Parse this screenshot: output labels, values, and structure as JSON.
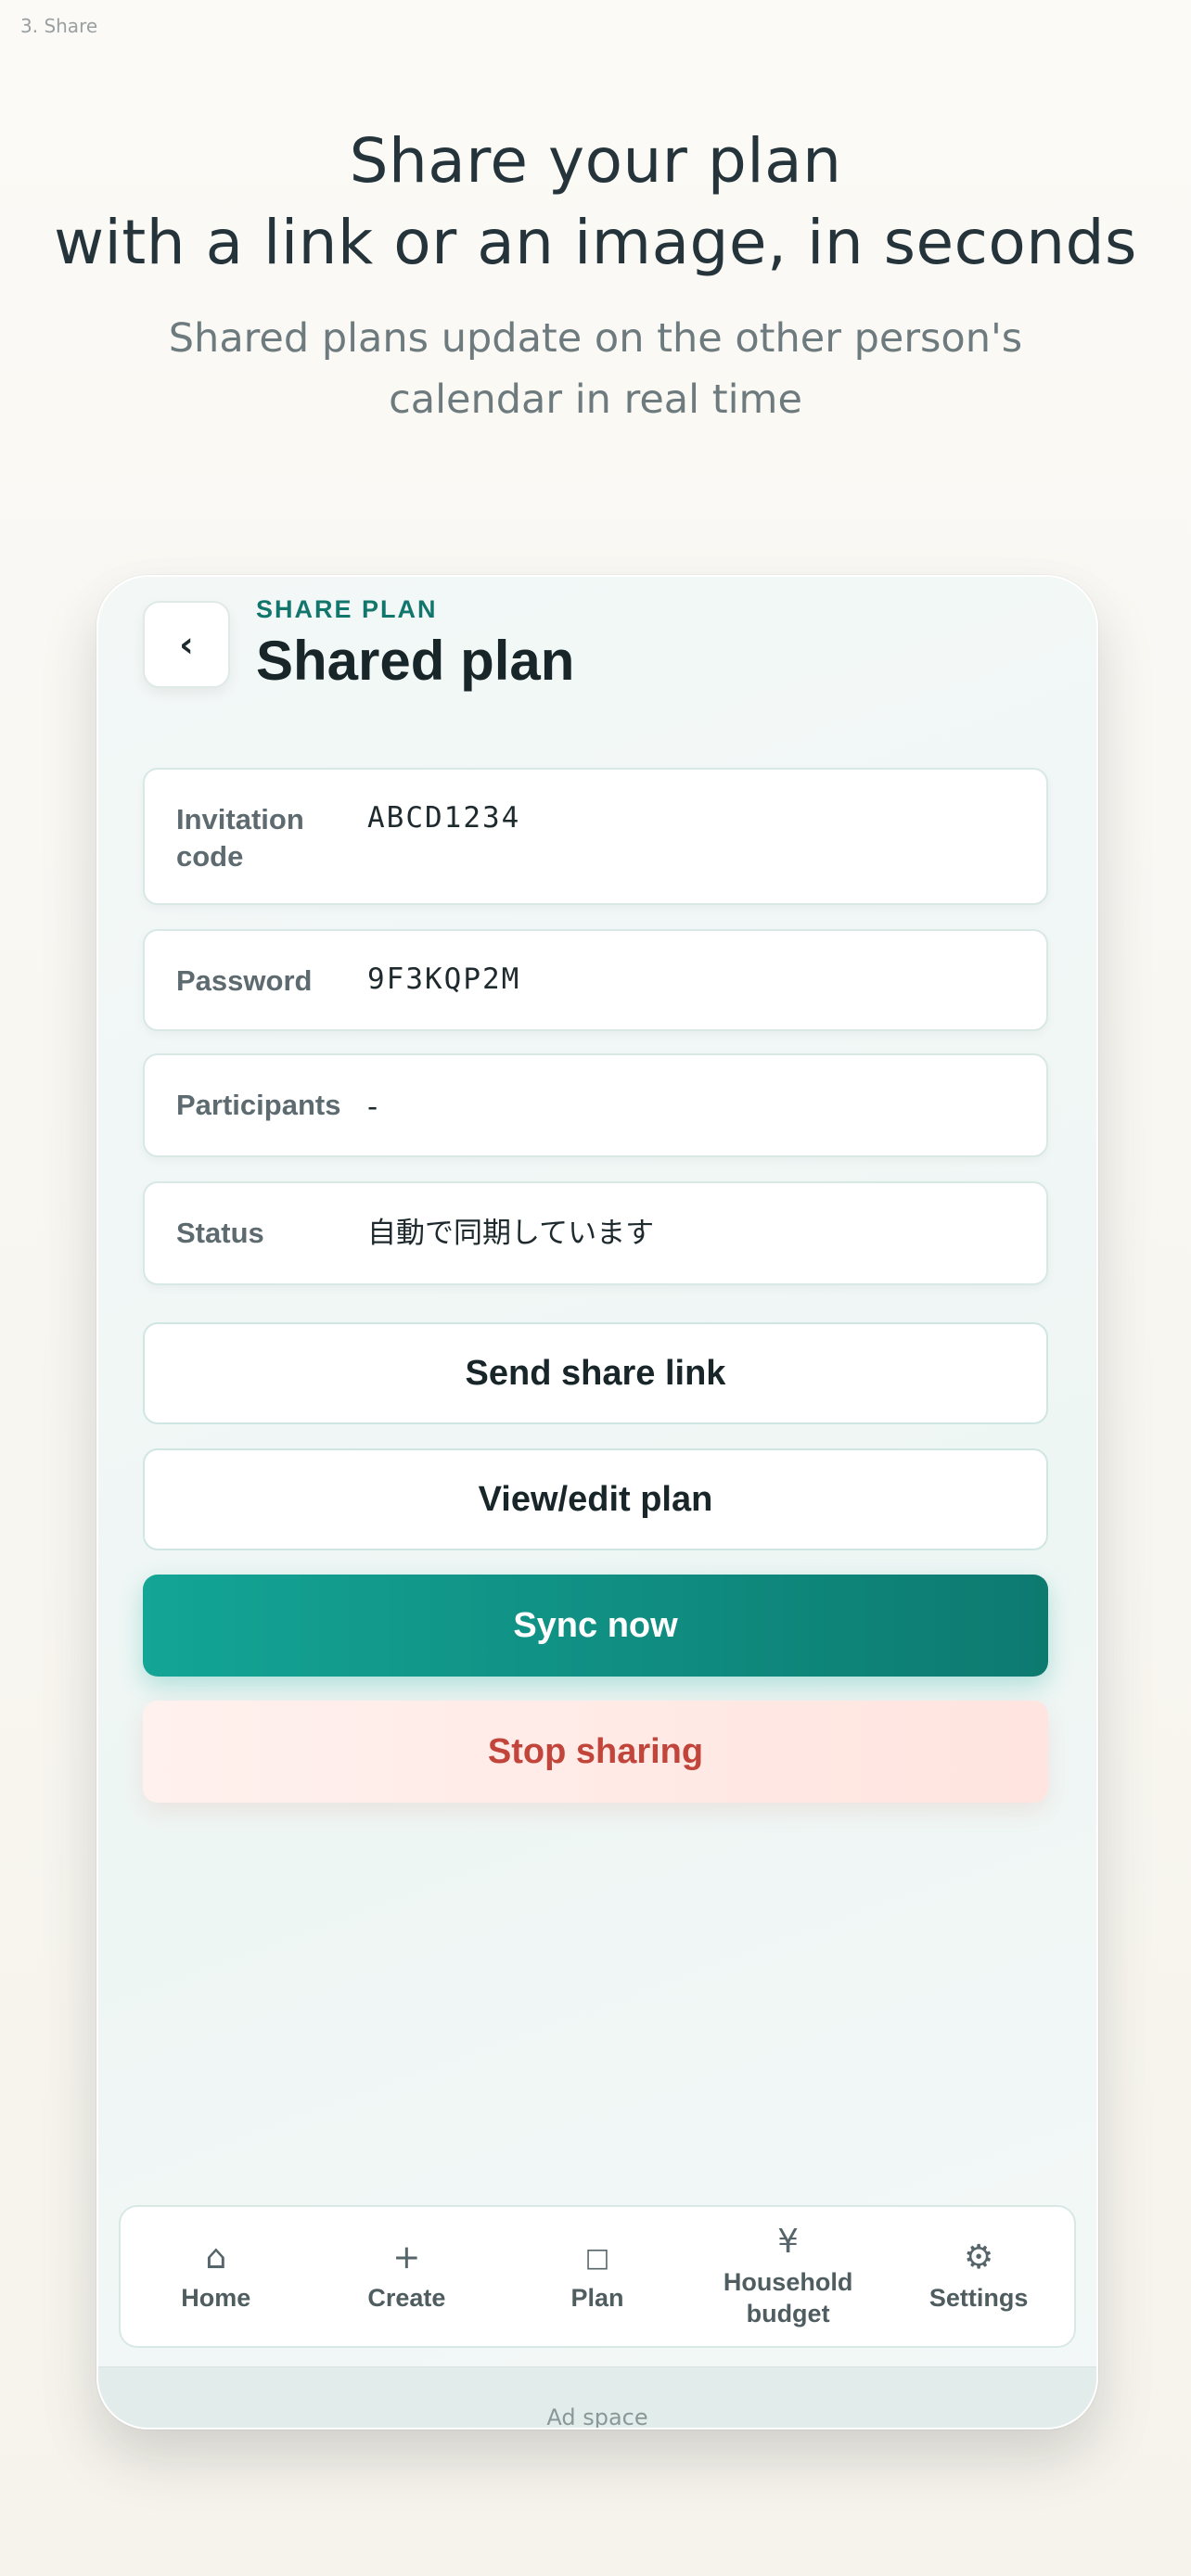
{
  "step_label": "3. Share",
  "hero": {
    "title_line1": "Share your plan",
    "title_line2": "with a link or an image, in seconds",
    "subtitle": "Shared plans update on the other person's calendar in real time"
  },
  "header": {
    "back_label": "‹",
    "eyebrow": "SHARE PLAN",
    "title": "Shared plan"
  },
  "fields": [
    {
      "label": "Invitation code",
      "value": "ABCD1234"
    },
    {
      "label": "Password",
      "value": "9F3KQP2M"
    },
    {
      "label": "Participants",
      "value": "-"
    },
    {
      "label": "Status",
      "value": "自動で同期しています"
    }
  ],
  "buttons": {
    "send_link": "Send share link",
    "view_edit": "View/edit plan",
    "sync_now": "Sync now",
    "stop_sharing": "Stop sharing"
  },
  "tabbar": {
    "items": [
      {
        "label": "Home",
        "icon": "home-icon",
        "glyph": "⌂"
      },
      {
        "label": "Create",
        "icon": "plus-icon",
        "glyph": "+"
      },
      {
        "label": "Plan",
        "icon": "square-icon",
        "glyph": "□"
      },
      {
        "label": "Household budget",
        "icon": "yen-icon",
        "glyph": "¥"
      },
      {
        "label": "Settings",
        "icon": "gear-icon",
        "glyph": "⚙"
      }
    ]
  },
  "ad_label": "Ad space",
  "colors": {
    "accent": "#13a596",
    "accent_dark": "#0d7a70",
    "danger": "#c1453b",
    "eyebrow": "#12766d"
  }
}
